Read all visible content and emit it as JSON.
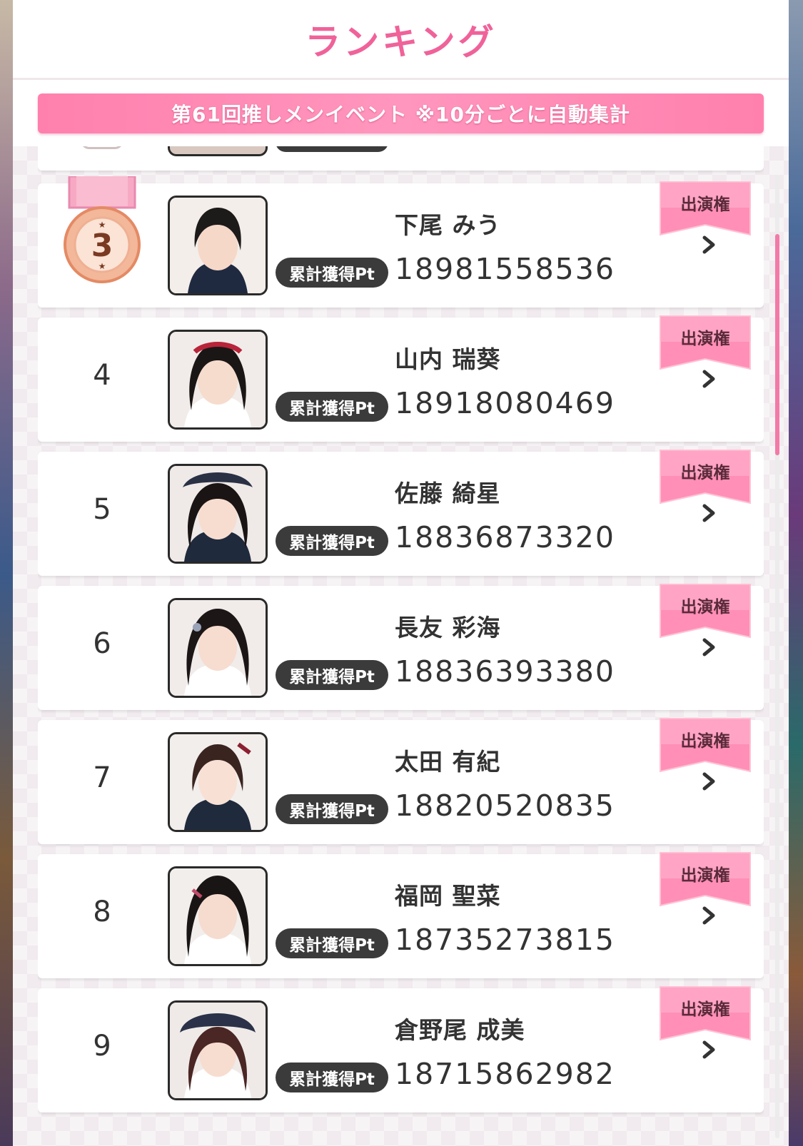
{
  "header": {
    "title": "ランキング"
  },
  "banner": {
    "text": "第61回推しメンイベント ※10分ごとに自動集計"
  },
  "pt_label": "累計獲得Pt",
  "ribbon_label": "出演権",
  "rows": [
    {
      "rank": "3",
      "name": "下尾 みう",
      "points": "18981558536",
      "medal": "bronze-medal"
    },
    {
      "rank": "4",
      "name": "山内 瑞葵",
      "points": "18918080469"
    },
    {
      "rank": "5",
      "name": "佐藤 綺星",
      "points": "18836873320"
    },
    {
      "rank": "6",
      "name": "長友 彩海",
      "points": "18836393380"
    },
    {
      "rank": "7",
      "name": "太田 有紀",
      "points": "18820520835"
    },
    {
      "rank": "8",
      "name": "福岡 聖菜",
      "points": "18735273815"
    },
    {
      "rank": "9",
      "name": "倉野尾 成美",
      "points": "18715862982"
    }
  ],
  "colors": {
    "accent_pink": "#f0629a",
    "banner_pink": "#ff80ad",
    "label_dark": "#3b3b3b",
    "bronze": "#e89a7a"
  },
  "icons": {
    "ribbon": "ribbon-badge-icon",
    "chevron": "chevron-right-icon",
    "medal": "bronze-medal-icon"
  }
}
